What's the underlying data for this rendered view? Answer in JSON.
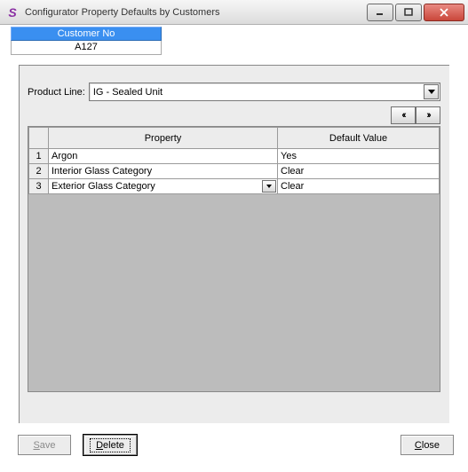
{
  "window": {
    "title": "Configurator Property Defaults by Customers"
  },
  "customer": {
    "header": "Customer No",
    "value": "A127"
  },
  "productLine": {
    "label": "Product Line:",
    "value": "IG - Sealed Unit"
  },
  "nav": {
    "prev": "‹‹",
    "next": "››"
  },
  "grid": {
    "headers": {
      "property": "Property",
      "value": "Default Value"
    },
    "rows": [
      {
        "n": "1",
        "property": "Argon",
        "value": "Yes",
        "dropdown": false
      },
      {
        "n": "2",
        "property": "Interior Glass Category",
        "value": "Clear",
        "dropdown": false
      },
      {
        "n": "3",
        "property": "Exterior Glass Category",
        "value": "Clear",
        "dropdown": true
      }
    ]
  },
  "buttons": {
    "save": "Save",
    "delete": "Delete",
    "close": "Close"
  }
}
